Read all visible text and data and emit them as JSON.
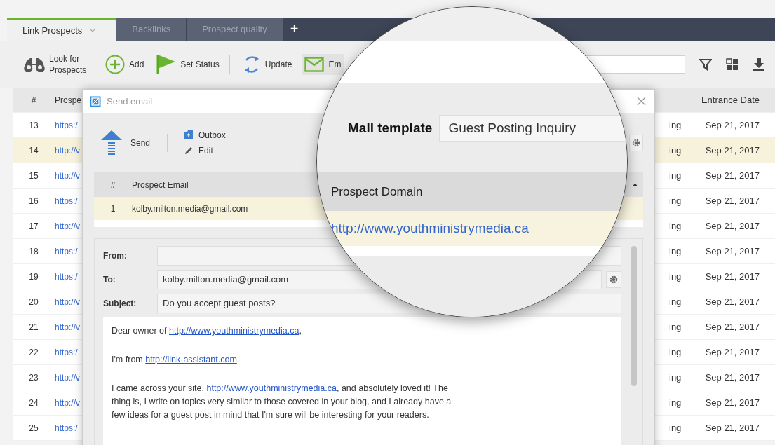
{
  "tabs": [
    {
      "label": "Link Prospects",
      "selected": true,
      "dropdown": true
    },
    {
      "label": "Backlinks",
      "selected": false,
      "dropdown": false
    },
    {
      "label": "Prospect quality",
      "selected": false,
      "dropdown": false
    }
  ],
  "add_tab": "+",
  "toolbar": [
    {
      "label": "Look for Prospects",
      "kind": "binoculars"
    },
    {
      "label": "Add",
      "kind": "add"
    },
    {
      "label": "Set Status",
      "kind": "flag"
    },
    {
      "label": "Update",
      "kind": "refresh"
    },
    {
      "label": "Em",
      "kind": "email"
    }
  ],
  "table": {
    "columns": [
      "#",
      "Prospe",
      "Entrance Date"
    ],
    "rows": [
      {
        "number": "13",
        "url": "https:/",
        "status": "ing",
        "date": "Sep 21, 2017",
        "selected": false
      },
      {
        "number": "14",
        "url": "http://v",
        "status": "ing",
        "date": "Sep 21, 2017",
        "selected": true
      },
      {
        "number": "15",
        "url": "http://v",
        "status": "ing",
        "date": "Sep 21, 2017",
        "selected": false
      },
      {
        "number": "16",
        "url": "https:/",
        "status": "ing",
        "date": "Sep 21, 2017",
        "selected": false
      },
      {
        "number": "17",
        "url": "http://v",
        "status": "ing",
        "date": "Sep 21, 2017",
        "selected": false
      },
      {
        "number": "18",
        "url": "https:/",
        "status": "ing",
        "date": "Sep 21, 2017",
        "selected": false
      },
      {
        "number": "19",
        "url": "https:/",
        "status": "ing",
        "date": "Sep 21, 2017",
        "selected": false
      },
      {
        "number": "20",
        "url": "http://v",
        "status": "ing",
        "date": "Sep 21, 2017",
        "selected": false
      },
      {
        "number": "21",
        "url": "http://v",
        "status": "ing",
        "date": "Sep 21, 2017",
        "selected": false
      },
      {
        "number": "22",
        "url": "https:/",
        "status": "ing",
        "date": "Sep 21, 2017",
        "selected": false
      },
      {
        "number": "23",
        "url": "http://v",
        "status": "ing",
        "date": "Sep 21, 2017",
        "selected": false
      },
      {
        "number": "24",
        "url": "http://v",
        "status": "ing",
        "date": "Sep 21, 2017",
        "selected": false
      },
      {
        "number": "25",
        "url": "https:/",
        "status": "ing",
        "date": "Sep 21, 2017",
        "selected": false
      }
    ]
  },
  "dialog": {
    "title": "Send email",
    "send": "Send",
    "outbox": "Outbox",
    "edit": "Edit",
    "grid": {
      "columns": [
        "#",
        "Prospect Email"
      ],
      "rows": [
        {
          "number": "1",
          "email": "kolby.milton.media@gmail.com",
          "selected": true
        }
      ]
    },
    "from": {
      "label": "From:"
    },
    "to": {
      "label": "To:",
      "value": "kolby.milton.media@gmail.com"
    },
    "subject": {
      "label": "Subject:",
      "value": "Do you accept guest posts?"
    },
    "body": [
      [
        {
          "kind": "text",
          "text": "Dear owner of "
        },
        {
          "kind": "link",
          "text": "http://www.youthministrymedia.ca"
        },
        {
          "kind": "text",
          "text": ","
        }
      ],
      [
        {
          "kind": "text",
          "text": "I'm  from "
        },
        {
          "kind": "link",
          "text": "http://link-assistant.com"
        },
        {
          "kind": "text",
          "text": "."
        }
      ],
      [
        {
          "kind": "text",
          "text": "I came across your site, "
        },
        {
          "kind": "link",
          "text": "http://www.youthministrymedia.ca"
        },
        {
          "kind": "text",
          "text": ", and absolutely loved it! The thing is, I write on topics very similar to those covered in your blog, and I already have a few ideas for a guest post in mind that I'm sure will be interesting for your readers."
        }
      ]
    ]
  },
  "magnifier": {
    "template_label": "Mail template",
    "template_value": "Guest Posting Inquiry",
    "column": "Prospect Domain",
    "row": {
      "url": "http://www.youthministrymedia.ca",
      "selected": true
    }
  }
}
